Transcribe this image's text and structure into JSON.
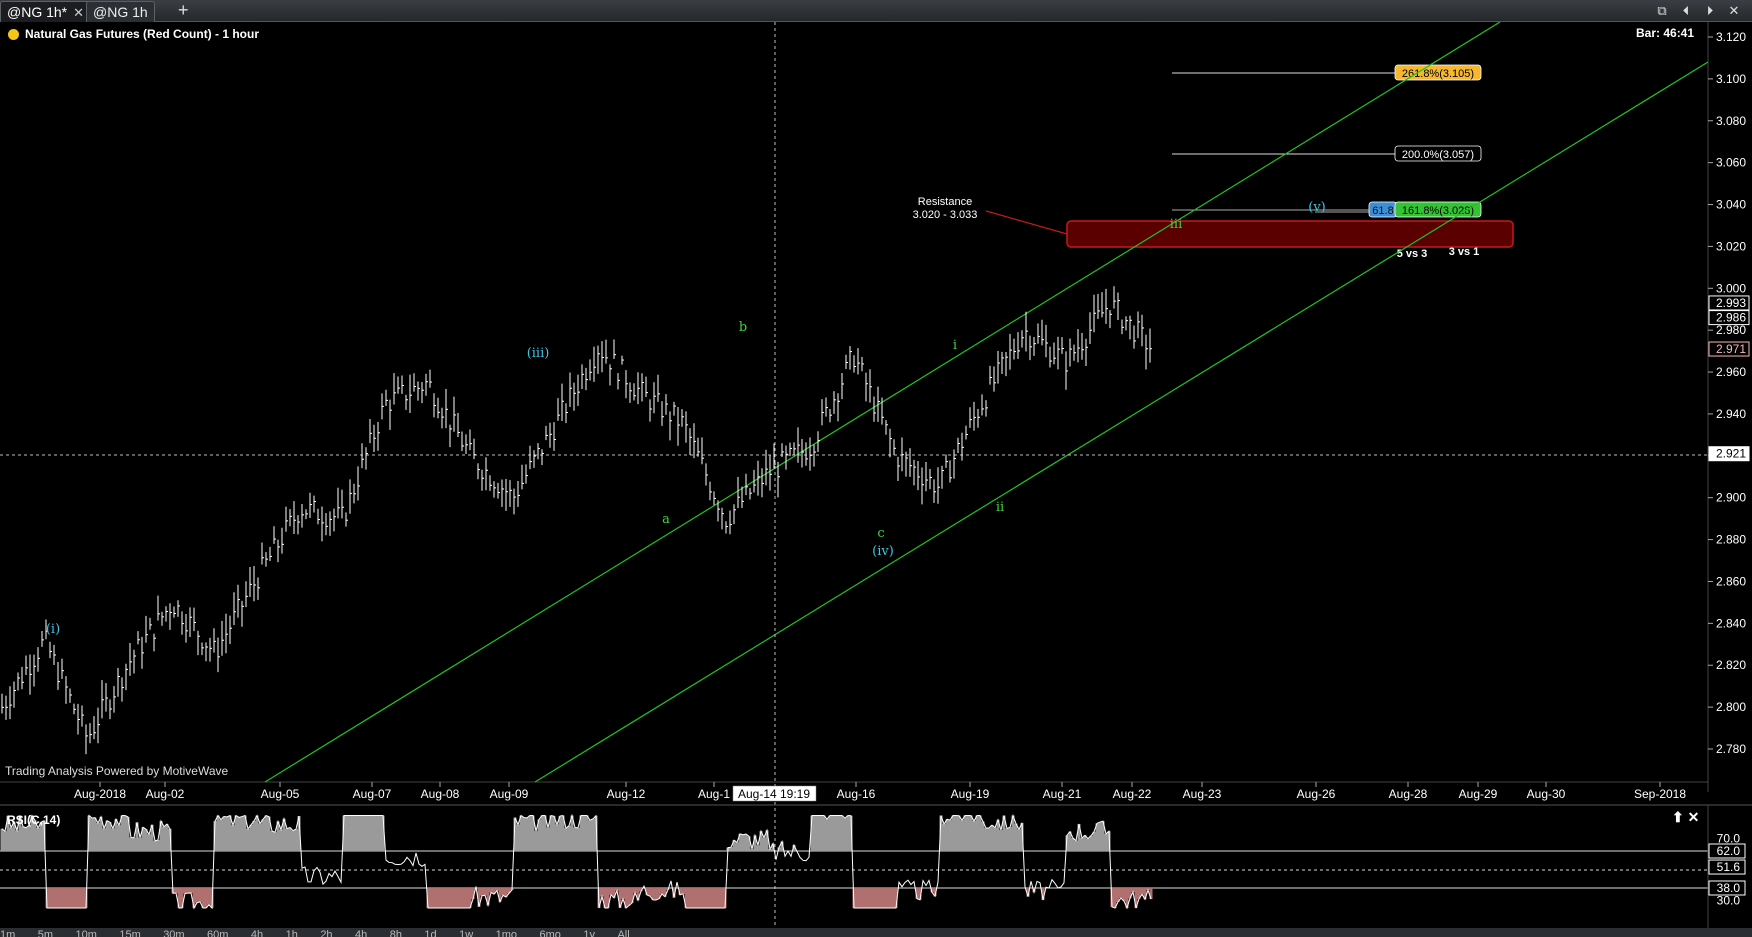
{
  "tabs": [
    {
      "label": "@NG 1h*",
      "active": true
    },
    {
      "label": "@NG 1h",
      "active": false
    }
  ],
  "tab_close": "✕",
  "tab_add": "+",
  "window_buttons": [
    "⧉",
    "⏴",
    "⏵",
    "✕"
  ],
  "chart": {
    "title": "Natural Gas Futures (Red Count) - 1 hour",
    "bar_timer": "Bar: 46:41",
    "watermark": "Trading Analysis Powered by MotiveWave",
    "crosshair_time": "Aug-14 19:19",
    "crosshair_price": "2.921"
  },
  "price_axis": {
    "ticks": [
      "3.120",
      "3.100",
      "3.080",
      "3.060",
      "3.040",
      "3.020",
      "3.000",
      "2.980",
      "2.960",
      "2.940",
      "2.920",
      "2.900",
      "2.880",
      "2.860",
      "2.840",
      "2.820",
      "2.800",
      "2.780"
    ],
    "labels": [
      {
        "text": "2.993",
        "color": "#ffffff",
        "price": 2.993
      },
      {
        "text": "2.986",
        "color": "#ffffff",
        "price": 2.986
      },
      {
        "text": "2.971",
        "color": "#f4b6b6",
        "price": 2.971
      },
      {
        "text": "2.921",
        "color": "#ffffff",
        "price": 2.921
      }
    ]
  },
  "time_axis": {
    "ticks": [
      "Aug-2018",
      "Aug-02",
      "Aug-05",
      "Aug-07",
      "Aug-08",
      "Aug-09",
      "Aug-12",
      "Aug-1",
      "Aug-16",
      "Aug-19",
      "Aug-21",
      "Aug-22",
      "Aug-23",
      "Aug-26",
      "Aug-28",
      "Aug-29",
      "Aug-30",
      "Sep-2018"
    ]
  },
  "annotations": {
    "resistance_title": "Resistance",
    "resistance_range": "3.020 - 3.033",
    "fib_261": "261.8%(3.105)",
    "fib_200": "200.0%(3.057)",
    "fib_161": "161.8%(3.028)",
    "fib_618_partial": "61.8",
    "ratio_text": "5 vs 3",
    "ratio_text2": "3 vs 1",
    "waves": {
      "i_paren": "(i)",
      "iii_paren": "(iii)",
      "iv_paren": "(iv)",
      "v_paren": "(v)",
      "a": "a",
      "b": "b",
      "c": "c",
      "i": "i",
      "ii": "ii",
      "iii": "iii"
    }
  },
  "rsi": {
    "title": "RSI(C,14)",
    "ticks": [
      "70.0",
      "62.0",
      "51.6",
      "38.0",
      "30.0"
    ],
    "upper": 62.0,
    "lower": 38.0,
    "current": 51.6,
    "buttons": [
      "⬆",
      "✕"
    ]
  },
  "timeframe_bar": [
    "1m",
    "5m",
    "10m",
    "15m",
    "30m",
    "60m",
    "4h",
    "1h",
    "2h",
    "4h",
    "8h",
    "1d",
    "1w",
    "1mo",
    "6mo",
    "1y",
    "All"
  ],
  "colors": {
    "background": "#000000",
    "price_bars": "#ffffff",
    "channel": "#22c322",
    "wave_blue": "#3ec6e6",
    "wave_green": "#3fd43f",
    "resistance_fill": "#5a0000",
    "resistance_border": "#c41a1a",
    "fib_gold": "#f5b82e",
    "fib_green": "#34c334",
    "fib_blue": "#3c8fd6"
  },
  "chart_data": {
    "type": "ohlc",
    "symbol": "NG",
    "interval": "1 hour",
    "ylim": [
      2.77,
      3.125
    ],
    "series": [
      {
        "name": "Natural Gas Futures",
        "close_points": [
          {
            "x": "Aug-2018",
            "y": 2.8
          },
          {
            "x": "Aug-01",
            "y": 2.832
          },
          {
            "x": "Aug-02",
            "y": 2.785
          },
          {
            "x": "Aug-02",
            "y": 2.822
          },
          {
            "x": "Aug-05",
            "y": 2.85
          },
          {
            "x": "Aug-06",
            "y": 2.826
          },
          {
            "x": "Aug-07",
            "y": 2.862
          },
          {
            "x": "Aug-07",
            "y": 2.895
          },
          {
            "x": "Aug-08",
            "y": 2.89
          },
          {
            "x": "Aug-08",
            "y": 2.945
          },
          {
            "x": "Aug-09",
            "y": 2.955
          },
          {
            "x": "Aug-12",
            "y": 2.92
          },
          {
            "x": "Aug-12",
            "y": 2.9
          },
          {
            "x": "Aug-13",
            "y": 2.935
          },
          {
            "x": "Aug-14",
            "y": 2.972
          },
          {
            "x": "Aug-14",
            "y": 2.95
          },
          {
            "x": "Aug-15",
            "y": 2.935
          },
          {
            "x": "Aug-16",
            "y": 2.89
          },
          {
            "x": "Aug-16",
            "y": 2.912
          },
          {
            "x": "Aug-18",
            "y": 2.925
          },
          {
            "x": "Aug-19",
            "y": 2.968
          },
          {
            "x": "Aug-19",
            "y": 2.92
          },
          {
            "x": "Aug-20",
            "y": 2.905
          },
          {
            "x": "Aug-20",
            "y": 2.945
          },
          {
            "x": "Aug-21",
            "y": 2.98
          },
          {
            "x": "Aug-21",
            "y": 2.965
          },
          {
            "x": "Aug-22",
            "y": 2.993
          },
          {
            "x": "Aug-22",
            "y": 2.971
          }
        ]
      }
    ]
  }
}
